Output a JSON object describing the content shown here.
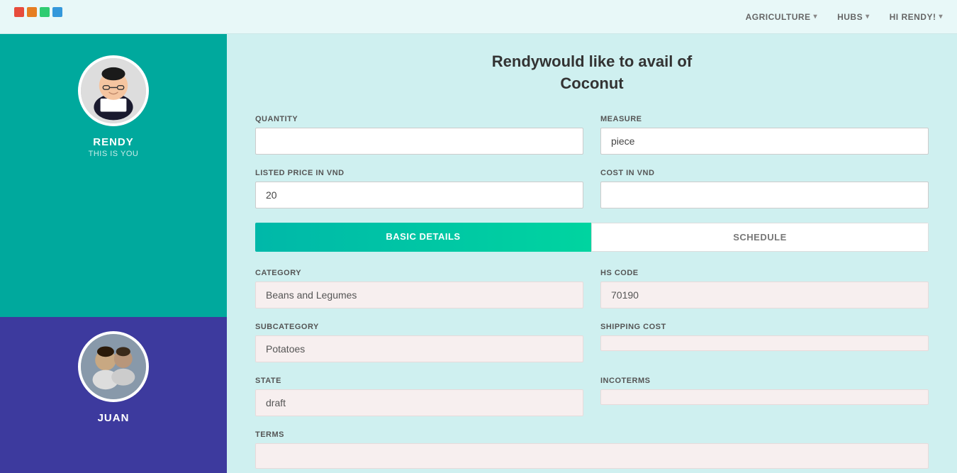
{
  "topnav": {
    "logo_colors": [
      "#e74c3c",
      "#e67e22",
      "#2ecc71",
      "#3498db"
    ],
    "nav_items": [
      {
        "label": "AGRICULTURE",
        "id": "agriculture"
      },
      {
        "label": "HUBS",
        "id": "hubs"
      },
      {
        "label": "HI RENDY!",
        "id": "hi-rendy"
      }
    ]
  },
  "sidebar": {
    "top_user": {
      "name": "RENDY",
      "subtitle": "THIS IS YOU"
    },
    "bottom_user": {
      "name": "JUAN"
    }
  },
  "page": {
    "title_line1": "Rendywould like to avail of",
    "title_line2": "Coconut"
  },
  "form": {
    "quantity_label": "QUANTITY",
    "quantity_value": "",
    "measure_label": "MEASURE",
    "measure_value": "piece",
    "listed_price_label": "LISTED PRICE IN VND",
    "listed_price_value": "20",
    "cost_label": "COST IN VND",
    "cost_value": ""
  },
  "tabs": {
    "basic_details": "BASIC DETAILS",
    "schedule": "SCHEDULE"
  },
  "details": {
    "category_label": "CATEGORY",
    "category_value": "Beans and Legumes",
    "hs_code_label": "HS CODE",
    "hs_code_value": "70190",
    "subcategory_label": "SUBCATEGORY",
    "subcategory_value": "Potatoes",
    "shipping_cost_label": "SHIPPING COST",
    "shipping_cost_value": "",
    "state_label": "STATE",
    "state_value": "draft",
    "incoterms_label": "INCOTERMS",
    "incoterms_value": "",
    "terms_label": "TERMS",
    "terms_value": ""
  }
}
